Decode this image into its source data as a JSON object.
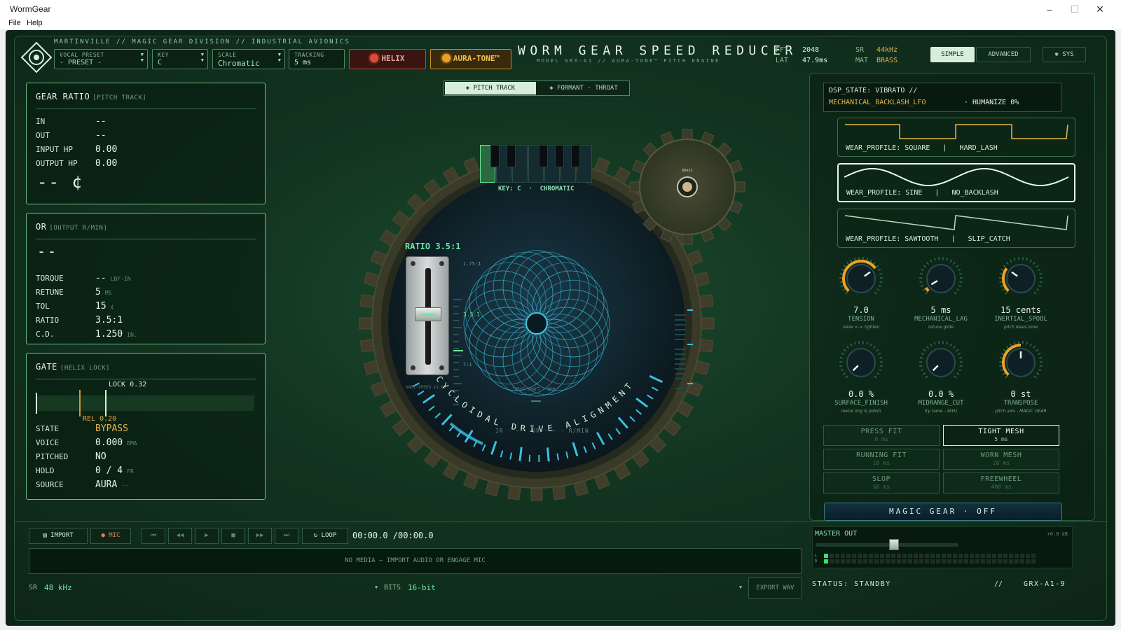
{
  "window": {
    "title": "WormGear",
    "menu": [
      "File",
      "Help"
    ],
    "controls": [
      "–",
      "☐",
      "✕"
    ]
  },
  "header": {
    "tagline": "MARTINVILLE // MAGIC GEAR DIVISION // INDUSTRIAL AVIONICS",
    "title": "WORM GEAR SPEED REDUCER",
    "subtitle": "MODEL GRX-A1 // AURA-TONE™ PITCH ENGINE",
    "vocal_preset": {
      "label": "VOCAL PRESET",
      "value": "- PRESET -"
    },
    "key": {
      "label": "KEY",
      "value": "C"
    },
    "scale": {
      "label": "SCALE",
      "value": "Chromatic"
    },
    "tracking": {
      "label": "TRACKING",
      "value": "5 ms"
    },
    "helix_label": "HELIX",
    "auratone_label": "AURA-TONE™",
    "stats": {
      "fft_label": "FFT",
      "fft": "2048",
      "lat_label": "LAT",
      "lat": "47.9ms",
      "sr_label": "SR",
      "sr": "44kHz",
      "mat_label": "MAT",
      "mat": "BRASS"
    },
    "mode_simple": "SIMPLE",
    "mode_advanced": "ADVANCED",
    "sys_label": "✱ SYS"
  },
  "gear_ratio_panel": {
    "title": "GEAR RATIO",
    "subtitle": "[PITCH TRACK]",
    "rows": [
      {
        "key": "IN",
        "value": "--"
      },
      {
        "key": "OUT",
        "value": "--"
      },
      {
        "key": "INPUT HP",
        "value": "0.00"
      },
      {
        "key": "OUTPUT HP",
        "value": "0.00"
      }
    ],
    "cents": "-- ¢"
  },
  "or_panel": {
    "title": "OR",
    "subtitle": "[OUTPUT R/MIN]",
    "big": "--",
    "rows": [
      {
        "key": "TORQUE",
        "value": "--",
        "unit": "LBF-IN"
      },
      {
        "key": "RETUNE",
        "value": "5",
        "unit": "MS"
      },
      {
        "key": "TOL",
        "value": "15",
        "unit": "¢"
      },
      {
        "key": "RATIO",
        "value": "3.5:1",
        "unit": ""
      },
      {
        "key": "C.D.",
        "value": "1.250",
        "unit": "IN."
      }
    ]
  },
  "gate_panel": {
    "title": "GATE",
    "subtitle": "[HELIX LOCK]",
    "lock": "LOCK 0.32",
    "rel": "REL 0.20",
    "rows": [
      {
        "key": "STATE",
        "value": "BYPASS",
        "unit": ""
      },
      {
        "key": "VOICE",
        "value": "0.000",
        "unit": "EMA"
      },
      {
        "key": "PITCHED",
        "value": "NO",
        "unit": ""
      },
      {
        "key": "HOLD",
        "value": "0 / 4",
        "unit": "FR"
      },
      {
        "key": "SOURCE",
        "value": "AURA",
        "unit": "--"
      }
    ]
  },
  "center": {
    "tab_pitch": "◈ PITCH TRACK",
    "tab_formant": "◈ FORMANT · THROAT",
    "key_readout": "KEY: C  ·  CHROMATIC",
    "ratio_label": "RATIO 3.5:1",
    "slider_ticks": [
      "1.75:1",
      "3.5:1",
      "7:1"
    ],
    "vari_speed": "VARI-SPEED x1.00",
    "input_shaft": "INPUT SHAFT · BPM",
    "arc_text": "CYCLOIDAL DRIVE ALIGNMENT",
    "ir_or": "IR · — · OR · — · R/MIN",
    "gear_label": "BRASS"
  },
  "dsp_state": {
    "line1": "DSP_STATE: VIBRATO //",
    "line2": "MECHANICAL_BACKLASH_LFO",
    "humanize": "· HUMANIZE 0%"
  },
  "wear_profiles": [
    {
      "name": "WEAR_PROFILE: SQUARE   |   HARD_LASH",
      "active": false
    },
    {
      "name": "WEAR_PROFILE: SINE   |   NO_BACKLASH",
      "active": true
    },
    {
      "name": "WEAR_PROFILE: SAWTOOTH   |   SLIP_CATCH",
      "active": false
    }
  ],
  "knobs": [
    {
      "value": "7.0",
      "label": "TENSION",
      "sub": "relax <-> tighten",
      "level": 0.7
    },
    {
      "value": "5 ms",
      "label": "MECHANICAL_LAG",
      "sub": "retune glide",
      "level": 0.05
    },
    {
      "value": "15 cents",
      "label": "INERTIAL_SPOOL",
      "sub": "pitch dead-zone",
      "level": 0.3
    },
    {
      "value": "0.0 %",
      "label": "SURFACE_FINISH",
      "sub": "metal ring & polish",
      "level": 0
    },
    {
      "value": "0.0 %",
      "label": "MIDRANGE_CUT",
      "sub": "fry tame - 3kHz",
      "level": 0
    },
    {
      "value": "0 st",
      "label": "TRANSPOSE",
      "sub": "pitch axis - MAGIC GEAR",
      "level": 0.5
    }
  ],
  "fits": [
    {
      "name": "PRESS FIT",
      "time": "0 ms",
      "active": false
    },
    {
      "name": "TIGHT MESH",
      "time": "5 ms",
      "active": true
    },
    {
      "name": "RUNNING FIT",
      "time": "10 ms",
      "active": false
    },
    {
      "name": "WORN MESH",
      "time": "20 ms",
      "active": false
    },
    {
      "name": "SLOP",
      "time": "60 ms",
      "active": false
    },
    {
      "name": "FREEWHEEL",
      "time": "400 ms",
      "active": false
    }
  ],
  "magic_gear": "MAGIC GEAR · OFF",
  "transport": {
    "import": "▤ IMPORT",
    "mic": "● MIC",
    "buttons": [
      "⏮",
      "◀◀",
      "▶",
      "■",
      "▶▶",
      "⏭"
    ],
    "loop": "↻ LOOP",
    "time": "00:00.0 /00:00.0",
    "no_media": "NO MEDIA — IMPORT AUDIO OR ENGAGE MIC",
    "sr_label": "SR",
    "sr": "48 kHz",
    "bits_label": "BITS",
    "bits": "16-bit",
    "export": "EXPORT WAV"
  },
  "master": {
    "label": "MASTER OUT",
    "db": "+0.0 dB",
    "level": 0.55,
    "ch_l": "L",
    "ch_r": "R"
  },
  "status": {
    "text": "STATUS: STANDBY",
    "sep": "//",
    "id": "GRX-A1-9"
  }
}
